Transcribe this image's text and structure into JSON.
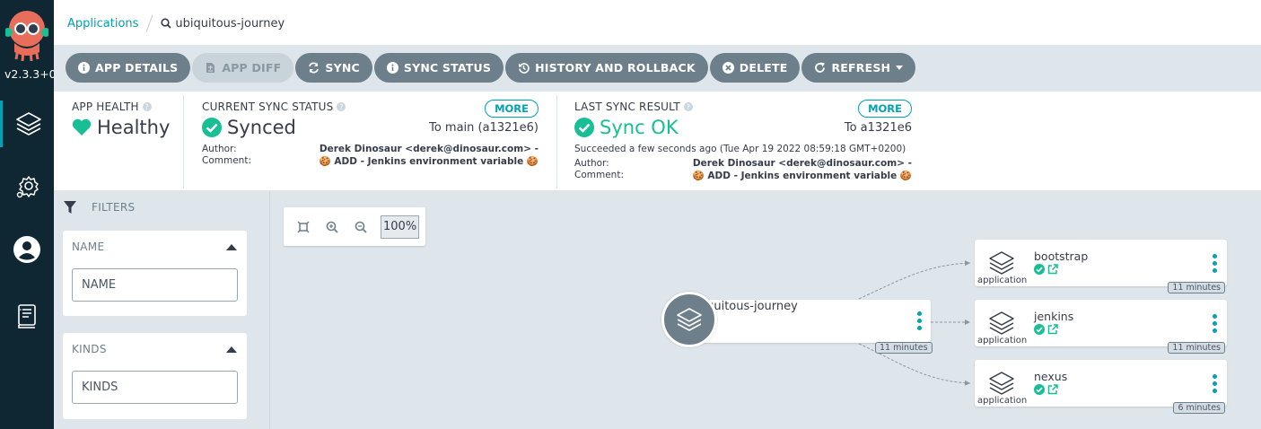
{
  "nav": {
    "version": "v2.3.3+0",
    "items": [
      {
        "name": "applications",
        "icon": "layers-icon"
      },
      {
        "name": "settings",
        "icon": "gear-icon"
      },
      {
        "name": "user",
        "icon": "user-icon"
      },
      {
        "name": "docs",
        "icon": "book-icon"
      }
    ]
  },
  "breadcrumb": {
    "root": "Applications",
    "current": "ubiquitous-journey"
  },
  "toolbar": {
    "app_details": "APP DETAILS",
    "app_diff": "APP DIFF",
    "sync": "SYNC",
    "sync_status": "SYNC STATUS",
    "history": "HISTORY AND ROLLBACK",
    "delete": "DELETE",
    "refresh": "REFRESH"
  },
  "status": {
    "health": {
      "label": "APP HEALTH",
      "value": "Healthy"
    },
    "current_sync": {
      "label": "CURRENT SYNC STATUS",
      "value": "Synced",
      "more": "MORE",
      "to": "To main (a1321e6)",
      "author_label": "Author:",
      "author": "Derek Dinosaur <derek@dinosaur.com> -",
      "comment_label": "Comment:",
      "comment": "🍪 ADD - Jenkins environment variable 🍪"
    },
    "last_sync": {
      "label": "LAST SYNC RESULT",
      "value": "Sync OK",
      "more": "MORE",
      "to": "To a1321e6",
      "note": "Succeeded a few seconds ago (Tue Apr 19 2022 08:59:18 GMT+0200)",
      "author_label": "Author:",
      "author": "Derek Dinosaur <derek@dinosaur.com> -",
      "comment_label": "Comment:",
      "comment": "🍪 ADD - Jenkins environment variable 🍪"
    }
  },
  "filters": {
    "title": "FILTERS",
    "name": {
      "title": "NAME",
      "placeholder": "NAME"
    },
    "kinds": {
      "title": "KINDS",
      "placeholder": "KINDS"
    }
  },
  "zoom": {
    "level": "100%"
  },
  "tree": {
    "root": {
      "name": "ubiquitous-journey",
      "age": "11 minutes"
    },
    "children": [
      {
        "name": "bootstrap",
        "type": "application",
        "age": "11 minutes"
      },
      {
        "name": "jenkins",
        "type": "application",
        "age": "11 minutes"
      },
      {
        "name": "nexus",
        "type": "application",
        "age": "6 minutes"
      }
    ]
  },
  "colors": {
    "teal": "#00a2b3",
    "green": "#18be94",
    "nav_bg": "#0f2733",
    "toolbar_btn": "#6d7f8b"
  }
}
